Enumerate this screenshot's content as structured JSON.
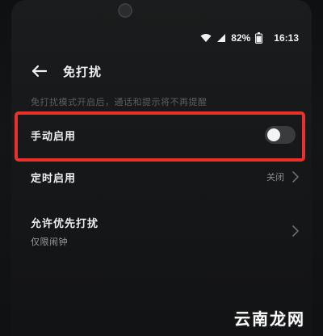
{
  "status_bar": {
    "battery": "82%",
    "time": "16:13"
  },
  "header": {
    "back_icon": "arrow-left-icon",
    "title": "免打扰"
  },
  "description": "免打扰模式开启后，通话和提示将不再提醒",
  "settings": {
    "manual": {
      "label": "手动启用",
      "enabled": false
    },
    "timer": {
      "label": "定时启用",
      "value": "关闭"
    },
    "allow": {
      "label": "允许优先打扰",
      "sub": "仅限闹钟"
    }
  },
  "watermark": "云南龙网",
  "colors": {
    "highlight": "#e8312a",
    "background": "#161718"
  }
}
